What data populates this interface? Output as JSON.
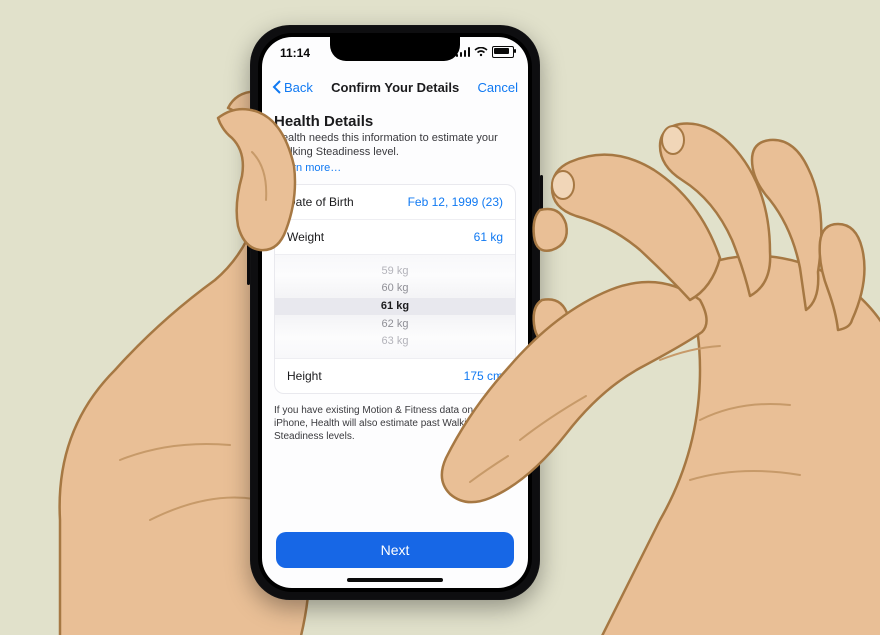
{
  "status": {
    "time": "11:14"
  },
  "nav": {
    "back": "Back",
    "title": "Confirm Your Details",
    "cancel": "Cancel"
  },
  "header": {
    "title": "Health Details",
    "subtitle": "Health needs this information to estimate your Walking Steadiness level.",
    "learn": "Learn more…"
  },
  "rows": {
    "dob_label": "Date of Birth",
    "dob_value": "Feb 12, 1999 (23)",
    "weight_label": "Weight",
    "weight_value": "61 kg",
    "height_label": "Height",
    "height_value": "175 cm"
  },
  "picker": {
    "m2": "59 kg",
    "m1": "60 kg",
    "sel": "61 kg",
    "p1": "62 kg",
    "p2": "63 kg"
  },
  "footer": "If you have existing Motion & Fitness data on your iPhone, Health will also estimate past Walking Steadiness levels.",
  "cta": "Next"
}
